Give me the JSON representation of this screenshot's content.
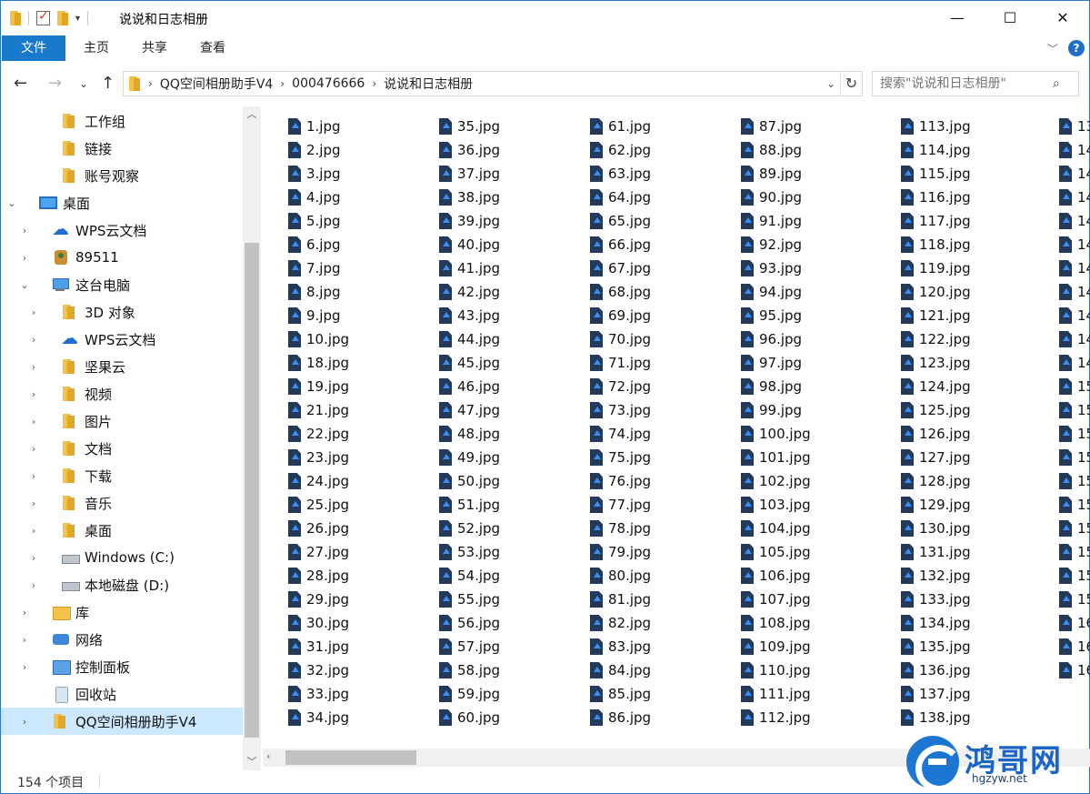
{
  "window": {
    "title": "说说和日志相册",
    "controls": {
      "minimize": "—",
      "maximize": "☐",
      "close": "✕"
    }
  },
  "ribbon": {
    "tabs": [
      "文件",
      "主页",
      "共享",
      "查看"
    ],
    "help": "?"
  },
  "address": {
    "crumbs": [
      "QQ空间相册助手V4",
      "000476666",
      "说说和日志相册"
    ],
    "search_placeholder": "搜索\"说说和日志相册\""
  },
  "nav": {
    "items": [
      {
        "label": "工作组",
        "icon": "folder-icon",
        "indent": 2,
        "expander": ""
      },
      {
        "label": "链接",
        "icon": "folder-icon",
        "indent": 2,
        "expander": ""
      },
      {
        "label": "账号观察",
        "icon": "folder-icon",
        "indent": 2,
        "expander": ""
      },
      {
        "label": "桌面",
        "icon": "desktop-icon",
        "indent": 0,
        "expander": "⌄"
      },
      {
        "label": "WPS云文档",
        "icon": "cloud-icon",
        "indent": 1,
        "expander": "›"
      },
      {
        "label": "89511",
        "icon": "user-icon",
        "indent": 1,
        "expander": "›"
      },
      {
        "label": "这台电脑",
        "icon": "computer-icon",
        "indent": 1,
        "expander": "⌄"
      },
      {
        "label": "3D 对象",
        "icon": "folder-icon",
        "indent": 2,
        "expander": "›"
      },
      {
        "label": "WPS云文档",
        "icon": "cloud-icon",
        "indent": 2,
        "expander": "›"
      },
      {
        "label": "坚果云",
        "icon": "folder-icon",
        "indent": 2,
        "expander": "›"
      },
      {
        "label": "视频",
        "icon": "folder-icon",
        "indent": 2,
        "expander": "›"
      },
      {
        "label": "图片",
        "icon": "folder-icon",
        "indent": 2,
        "expander": "›"
      },
      {
        "label": "文档",
        "icon": "folder-icon",
        "indent": 2,
        "expander": "›"
      },
      {
        "label": "下载",
        "icon": "folder-icon",
        "indent": 2,
        "expander": "›"
      },
      {
        "label": "音乐",
        "icon": "folder-icon",
        "indent": 2,
        "expander": "›"
      },
      {
        "label": "桌面",
        "icon": "folder-icon",
        "indent": 2,
        "expander": "›"
      },
      {
        "label": "Windows (C:)",
        "icon": "windows-drive-icon",
        "indent": 2,
        "expander": "›"
      },
      {
        "label": "本地磁盘 (D:)",
        "icon": "drive-icon",
        "indent": 2,
        "expander": "›"
      },
      {
        "label": "库",
        "icon": "library-icon",
        "indent": 1,
        "expander": "›"
      },
      {
        "label": "网络",
        "icon": "network-icon",
        "indent": 1,
        "expander": "›"
      },
      {
        "label": "控制面板",
        "icon": "control-panel-icon",
        "indent": 1,
        "expander": "›"
      },
      {
        "label": "回收站",
        "icon": "recycle-bin-icon",
        "indent": 1,
        "expander": ""
      },
      {
        "label": "QQ空间相册助手V4",
        "icon": "folder-icon",
        "indent": 1,
        "expander": "›",
        "selected": true
      }
    ]
  },
  "files": {
    "columns": [
      [
        "1.jpg",
        "2.jpg",
        "3.jpg",
        "4.jpg",
        "5.jpg",
        "6.jpg",
        "7.jpg",
        "8.jpg",
        "9.jpg",
        "10.jpg",
        "18.jpg",
        "19.jpg",
        "21.jpg",
        "22.jpg",
        "23.jpg",
        "24.jpg",
        "25.jpg",
        "26.jpg",
        "27.jpg",
        "28.jpg",
        "29.jpg",
        "30.jpg",
        "31.jpg",
        "32.jpg",
        "33.jpg",
        "34.jpg"
      ],
      [
        "35.jpg",
        "36.jpg",
        "37.jpg",
        "38.jpg",
        "39.jpg",
        "40.jpg",
        "41.jpg",
        "42.jpg",
        "43.jpg",
        "44.jpg",
        "45.jpg",
        "46.jpg",
        "47.jpg",
        "48.jpg",
        "49.jpg",
        "50.jpg",
        "51.jpg",
        "52.jpg",
        "53.jpg",
        "54.jpg",
        "55.jpg",
        "56.jpg",
        "57.jpg",
        "58.jpg",
        "59.jpg",
        "60.jpg"
      ],
      [
        "61.jpg",
        "62.jpg",
        "63.jpg",
        "64.jpg",
        "65.jpg",
        "66.jpg",
        "67.jpg",
        "68.jpg",
        "69.jpg",
        "70.jpg",
        "71.jpg",
        "72.jpg",
        "73.jpg",
        "74.jpg",
        "75.jpg",
        "76.jpg",
        "77.jpg",
        "78.jpg",
        "79.jpg",
        "80.jpg",
        "81.jpg",
        "82.jpg",
        "83.jpg",
        "84.jpg",
        "85.jpg",
        "86.jpg"
      ],
      [
        "87.jpg",
        "88.jpg",
        "89.jpg",
        "90.jpg",
        "91.jpg",
        "92.jpg",
        "93.jpg",
        "94.jpg",
        "95.jpg",
        "96.jpg",
        "97.jpg",
        "98.jpg",
        "99.jpg",
        "100.jpg",
        "101.jpg",
        "102.jpg",
        "103.jpg",
        "104.jpg",
        "105.jpg",
        "106.jpg",
        "107.jpg",
        "108.jpg",
        "109.jpg",
        "110.jpg",
        "111.jpg",
        "112.jpg"
      ],
      [
        "113.jpg",
        "114.jpg",
        "115.jpg",
        "116.jpg",
        "117.jpg",
        "118.jpg",
        "119.jpg",
        "120.jpg",
        "121.jpg",
        "122.jpg",
        "123.jpg",
        "124.jpg",
        "125.jpg",
        "126.jpg",
        "127.jpg",
        "128.jpg",
        "129.jpg",
        "130.jpg",
        "131.jpg",
        "132.jpg",
        "133.jpg",
        "134.jpg",
        "135.jpg",
        "136.jpg",
        "137.jpg",
        "138.jpg"
      ],
      [
        "13",
        "14",
        "14",
        "14",
        "14",
        "14",
        "14",
        "14",
        "14",
        "14",
        "14",
        "15",
        "15",
        "15",
        "15",
        "15",
        "15",
        "15",
        "15",
        "15",
        "15",
        "16",
        "16",
        "16"
      ]
    ]
  },
  "status": {
    "count": "154 个项目"
  },
  "watermark": {
    "name": "鸿哥网",
    "url": "hgzyw.net"
  }
}
